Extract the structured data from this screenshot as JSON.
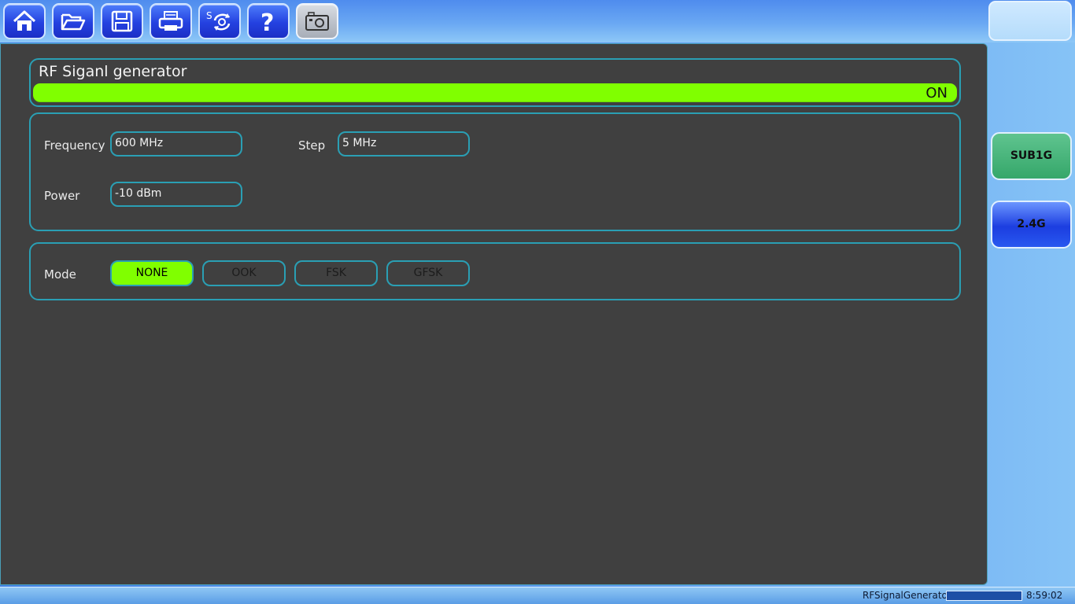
{
  "toolbar": {
    "buttons": [
      {
        "name": "home-icon"
      },
      {
        "name": "open-folder-icon"
      },
      {
        "name": "save-icon"
      },
      {
        "name": "print-icon"
      },
      {
        "name": "settings-sync-icon",
        "label": "S"
      },
      {
        "name": "help-icon",
        "label": "?"
      },
      {
        "name": "screenshot-icon"
      }
    ]
  },
  "panel": {
    "title": "RF Siganl generator",
    "state": "ON",
    "frequency": {
      "label": "Frequency",
      "value": "600 MHz"
    },
    "step": {
      "label": "Step",
      "value": "5 MHz"
    },
    "power": {
      "label": "Power",
      "value": "-10 dBm"
    },
    "mode": {
      "label": "Mode",
      "options": [
        "NONE",
        "OOK",
        "FSK",
        "GFSK"
      ],
      "selected": "NONE"
    }
  },
  "side": {
    "sub1g": "SUB1G",
    "band24": "2.4G"
  },
  "status": {
    "app_name": "RFSignalGenerator",
    "progress": 0,
    "time": "8:59:02"
  },
  "colors": {
    "accent_on": "#80ff00",
    "border": "#2a9fb4",
    "panel_bg": "#404040"
  }
}
